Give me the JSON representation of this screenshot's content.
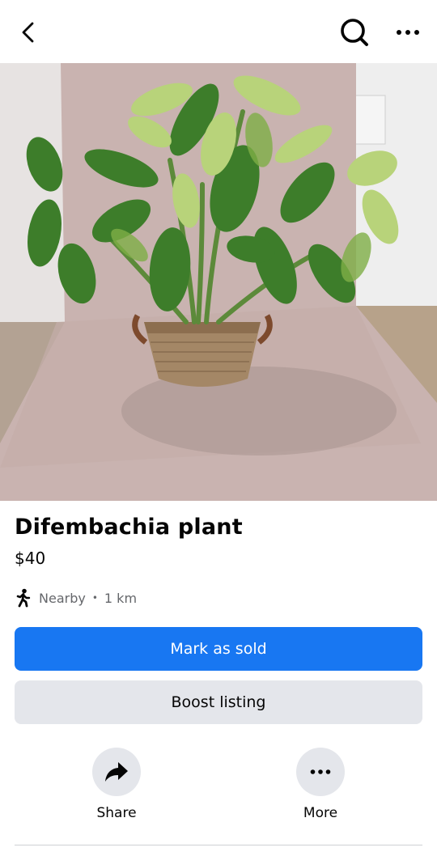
{
  "header": {
    "back_icon": "chevron-left-icon",
    "search_icon": "search-icon",
    "more_icon": "ellipsis-icon"
  },
  "listing": {
    "title": "Difembachia plant",
    "price": "$40",
    "location_icon": "walking-person-icon",
    "location_text": "Nearby",
    "distance": "1 km",
    "separator": "•"
  },
  "buttons": {
    "mark_sold": "Mark as sold",
    "boost": "Boost listing"
  },
  "actions": [
    {
      "label": "Share",
      "icon": "share-arrow-icon"
    },
    {
      "label": "More",
      "icon": "ellipsis-icon"
    }
  ],
  "colors": {
    "primary": "#1877f2",
    "secondary": "#e4e6eb",
    "muted_text": "#65676b"
  }
}
